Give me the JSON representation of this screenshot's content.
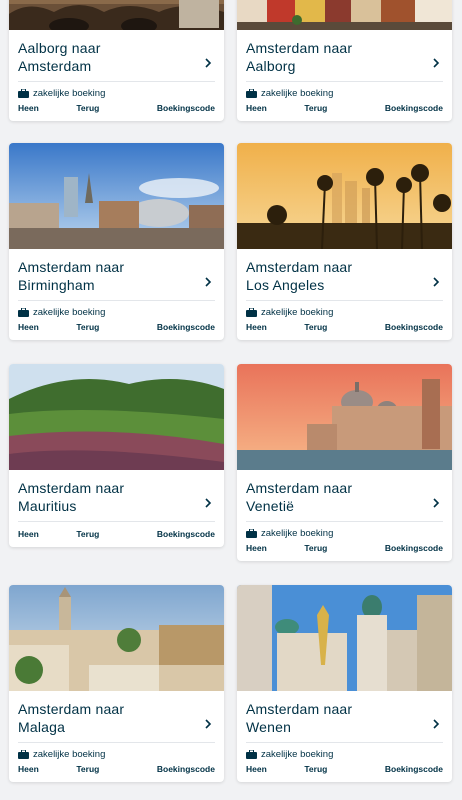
{
  "cards": [
    {
      "line1": "Aalborg naar",
      "line2": "Amsterdam",
      "business": "zakelijke boeking",
      "heen": "Heen",
      "terug": "Terug",
      "code": "Boekingscode",
      "image": "bridge-canal-photo"
    },
    {
      "line1": "Amsterdam naar",
      "line2": "Aalborg",
      "business": "zakelijke boeking",
      "heen": "Heen",
      "terug": "Terug",
      "code": "Boekingscode",
      "image": "colorful-houses-photo"
    },
    {
      "line1": "Amsterdam naar",
      "line2": "Birmingham",
      "business": "zakelijke boeking",
      "heen": "Heen",
      "terug": "Terug",
      "code": "Boekingscode",
      "image": "birmingham-skyline-photo"
    },
    {
      "line1": "Amsterdam naar",
      "line2": "Los Angeles",
      "business": "zakelijke boeking",
      "heen": "Heen",
      "terug": "Terug",
      "code": "Boekingscode",
      "image": "los-angeles-palms-photo"
    },
    {
      "line1": "Amsterdam naar",
      "line2": "Mauritius",
      "business": "",
      "heen": "Heen",
      "terug": "Terug",
      "code": "Boekingscode",
      "image": "mauritius-landscape-photo"
    },
    {
      "line1": "Amsterdam naar",
      "line2": "Venetië",
      "business": "zakelijke boeking",
      "heen": "Heen",
      "terug": "Terug",
      "code": "Boekingscode",
      "image": "venice-basilica-photo"
    },
    {
      "line1": "Amsterdam naar",
      "line2": "Malaga",
      "business": "zakelijke boeking",
      "heen": "Heen",
      "terug": "Terug",
      "code": "Boekingscode",
      "image": "malaga-city-photo"
    },
    {
      "line1": "Amsterdam naar",
      "line2": "Wenen",
      "business": "zakelijke boeking",
      "heen": "Heen",
      "terug": "Terug",
      "code": "Boekingscode",
      "image": "vienna-square-photo"
    }
  ]
}
